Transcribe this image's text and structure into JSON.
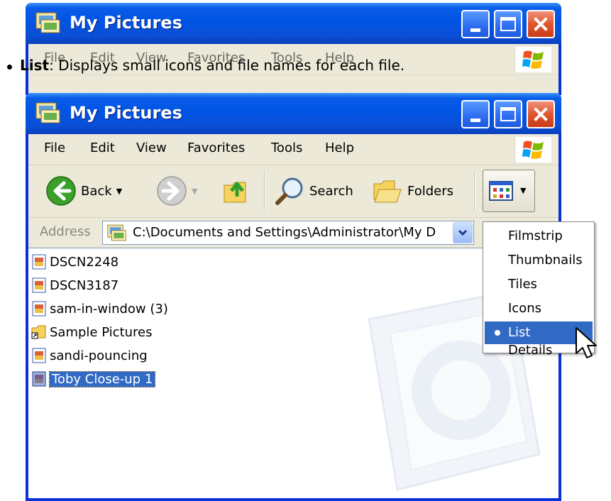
{
  "caption": {
    "term": "List",
    "text": ": Displays small icons and file names for each file."
  },
  "window": {
    "title": "My Pictures",
    "menu": [
      "File",
      "Edit",
      "View",
      "Favorites",
      "Tools",
      "Help"
    ],
    "toolbar": {
      "back": "Back",
      "search": "Search",
      "folders": "Folders"
    },
    "address_label": "Address",
    "address_value": "C:\\Documents and Settings\\Administrator\\My D"
  },
  "files": [
    {
      "name": "DSCN2248",
      "icon": "image-file-icon"
    },
    {
      "name": "DSCN3187",
      "icon": "image-file-icon"
    },
    {
      "name": "sam-in-window (3)",
      "icon": "image-file-icon"
    },
    {
      "name": "Sample Pictures",
      "icon": "folder-shortcut-icon"
    },
    {
      "name": "sandi-pouncing",
      "icon": "image-file-icon"
    },
    {
      "name": "Toby Close-up 1",
      "icon": "image-file-icon",
      "selected": true
    }
  ],
  "views_menu": {
    "items": [
      "Filmstrip",
      "Thumbnails",
      "Tiles",
      "Icons",
      "List",
      "Details"
    ],
    "selected": "List"
  },
  "colors": {
    "titlebar": "#0054e3",
    "selection": "#316ac5",
    "chrome": "#ece9d8"
  }
}
